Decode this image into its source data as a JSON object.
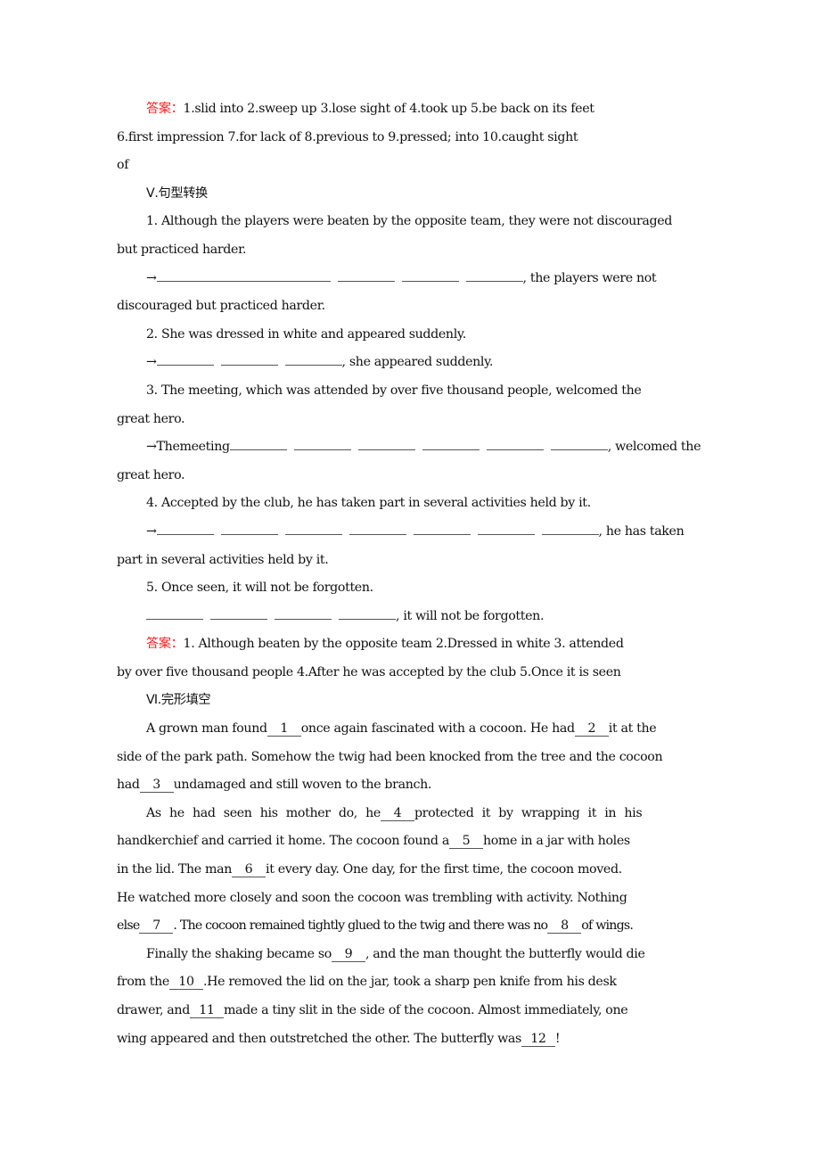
{
  "answer_label": "答案：",
  "section4_answers": {
    "line1": "1.slid into  2.sweep up  3.lose sight of  4.took up  5.be back on its feet",
    "line2": "6.first impression  7.for lack of  8.previous to  9.pressed; into  10.caught sight",
    "line3": "of"
  },
  "section5": {
    "heading": "Ⅴ.句型转换",
    "q1": {
      "line1": "1. Although the players were beaten by the opposite team, they were not discouraged",
      "line2": "but practiced harder.",
      "arrow": "→",
      "rest1": ",  the players were not",
      "rest2": "discouraged but practiced harder."
    },
    "q2": {
      "line1": "2. She was dressed in white and appeared suddenly.",
      "arrow": "→",
      "rest1": ",  she appeared suddenly."
    },
    "q3": {
      "line1": "3. The meeting, which was attended by over five thousand people, welcomed the",
      "line2": "great hero.",
      "arrow": "→Themeeting",
      "rest1": ",  welcomed the",
      "rest2": "great hero."
    },
    "q4": {
      "line1": "4. Accepted by the club, he has taken part in several activities held by it.",
      "arrow": "→",
      "rest1": ",  he has taken",
      "rest2": "part in several activities held by it."
    },
    "q5": {
      "line1": "5. Once seen, it will not be forgotten.",
      "rest1": ", it will not be forgotten."
    },
    "answers": {
      "line1": "1. Although beaten by the opposite team  2.Dressed in white  3. attended",
      "line2": "by over five thousand people  4.After he was accepted by the club  5.Once it is seen"
    }
  },
  "section6": {
    "heading": "Ⅵ.完形填空",
    "p1": {
      "a": "A grown man found",
      "n1": "1",
      "b": "once again fascinated with a cocoon. He had",
      "n2": "2",
      "c": "it at the",
      "line2": "side of the park path. Somehow the twig had been knocked from the tree and the cocoon",
      "d": "had",
      "n3": "3",
      "e": "undamaged and still woven to the branch."
    },
    "p2": {
      "a": "As he had seen his mother do, he",
      "n4": "4",
      "b": "protected it by wrapping it in his",
      "c": "handkerchief and carried it home. The cocoon found a",
      "n5": "5",
      "d": "home in a jar with holes",
      "e": "in the lid. The man",
      "n6": "6",
      "f": "it every day. One day, for the first time, the cocoon moved.",
      "line4": "He watched more closely and soon the cocoon was trembling with activity. Nothing",
      "g": "else",
      "n7": "7",
      "h": ". The cocoon remained tightly glued to the twig and there was no",
      "n8": "8",
      "i": "of wings."
    },
    "p3": {
      "a": "Finally the shaking became so",
      "n9": "9",
      "b": ",  and the man thought the butterfly would die",
      "c": "from the",
      "n10": "10",
      "d": ".He removed the lid on the jar, took a sharp pen knife from his desk",
      "e": "drawer, and",
      "n11": "11",
      "f": "made a tiny slit in the side of the cocoon. Almost immediately, one",
      "g": "wing appeared and then outstretched the other. The butterfly was",
      "n12": "12",
      "h": "!"
    }
  }
}
